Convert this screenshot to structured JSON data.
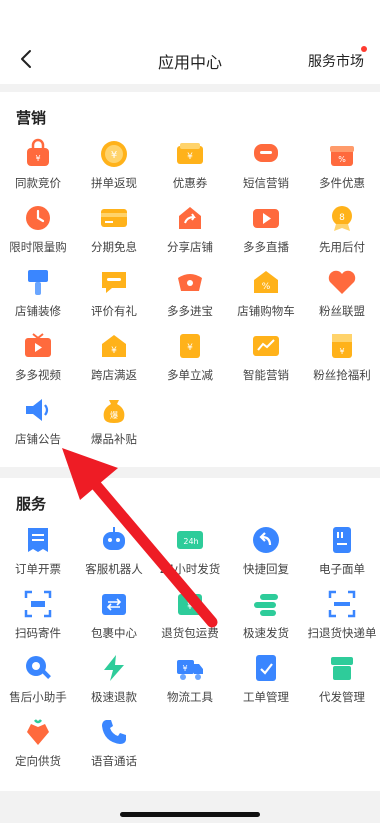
{
  "header": {
    "title": "应用中心",
    "market_label": "服务市场"
  },
  "marketing": {
    "title": "营销",
    "items": [
      {
        "label": "同款竞价",
        "icon": "bag-icon",
        "color": "#ff6a3d"
      },
      {
        "label": "拼单返现",
        "icon": "coin-icon",
        "color": "#ffb21a"
      },
      {
        "label": "优惠券",
        "icon": "coupon-icon",
        "color": "#ffb21a"
      },
      {
        "label": "短信营销",
        "icon": "message-icon",
        "color": "#ff6a3d"
      },
      {
        "label": "多件优惠",
        "icon": "gift-icon",
        "color": "#ff6a3d"
      },
      {
        "label": "限时限量购",
        "icon": "clock-icon",
        "color": "#ff6a3d"
      },
      {
        "label": "分期免息",
        "icon": "card-icon",
        "color": "#ffb21a"
      },
      {
        "label": "分享店铺",
        "icon": "share-icon",
        "color": "#ff6a3d"
      },
      {
        "label": "多多直播",
        "icon": "video-icon",
        "color": "#ff6a3d"
      },
      {
        "label": "先用后付",
        "icon": "badge-icon",
        "color": "#ffb21a"
      },
      {
        "label": "店铺装修",
        "icon": "brush-icon",
        "color": "#3a86ff"
      },
      {
        "label": "评价有礼",
        "icon": "comment-icon",
        "color": "#ffb21a"
      },
      {
        "label": "多多进宝",
        "icon": "treasure-icon",
        "color": "#ff6a3d"
      },
      {
        "label": "店铺购物车",
        "icon": "cart-shop-icon",
        "color": "#ffb21a"
      },
      {
        "label": "粉丝联盟",
        "icon": "heart-icon",
        "color": "#ff6a3d"
      },
      {
        "label": "多多视频",
        "icon": "tv-icon",
        "color": "#ff6a3d"
      },
      {
        "label": "跨店满返",
        "icon": "house-coin-icon",
        "color": "#ffb21a"
      },
      {
        "label": "多单立减",
        "icon": "discount-icon",
        "color": "#ffb21a"
      },
      {
        "label": "智能营销",
        "icon": "chart-icon",
        "color": "#ffb21a"
      },
      {
        "label": "粉丝抢福利",
        "icon": "envelope-icon",
        "color": "#ffb21a"
      },
      {
        "label": "店铺公告",
        "icon": "speaker-icon",
        "color": "#3a86ff"
      },
      {
        "label": "爆品补贴",
        "icon": "money-bag-icon",
        "color": "#ffb21a"
      }
    ]
  },
  "services": {
    "title": "服务",
    "items": [
      {
        "label": "订单开票",
        "icon": "invoice-icon",
        "color": "#3a86ff"
      },
      {
        "label": "客服机器人",
        "icon": "robot-icon",
        "color": "#3a86ff"
      },
      {
        "label": "24小时发货",
        "icon": "truck-24h-icon",
        "color": "#2ecc9a"
      },
      {
        "label": "快捷回复",
        "icon": "reply-icon",
        "color": "#3a86ff"
      },
      {
        "label": "电子面单",
        "icon": "ebill-icon",
        "color": "#3a86ff"
      },
      {
        "label": "扫码寄件",
        "icon": "scan-icon",
        "color": "#3a86ff"
      },
      {
        "label": "包裹中心",
        "icon": "package-icon",
        "color": "#3a86ff"
      },
      {
        "label": "退货包运费",
        "icon": "return-icon",
        "color": "#2ecc9a"
      },
      {
        "label": "极速发货",
        "icon": "fast-ship-icon",
        "color": "#2ecc9a"
      },
      {
        "label": "扫退货快递单",
        "icon": "scan-return-icon",
        "color": "#3a86ff"
      },
      {
        "label": "售后小助手",
        "icon": "wrench-icon",
        "color": "#3a86ff"
      },
      {
        "label": "极速退款",
        "icon": "lightning-icon",
        "color": "#2ecc9a"
      },
      {
        "label": "物流工具",
        "icon": "logistics-icon",
        "color": "#3a86ff"
      },
      {
        "label": "工单管理",
        "icon": "worksheet-icon",
        "color": "#3a86ff"
      },
      {
        "label": "代发管理",
        "icon": "dropship-icon",
        "color": "#2ecc9a"
      },
      {
        "label": "定向供货",
        "icon": "supply-icon",
        "color": "#ff6a3d"
      },
      {
        "label": "语音通话",
        "icon": "phone-icon",
        "color": "#3a86ff"
      }
    ]
  }
}
